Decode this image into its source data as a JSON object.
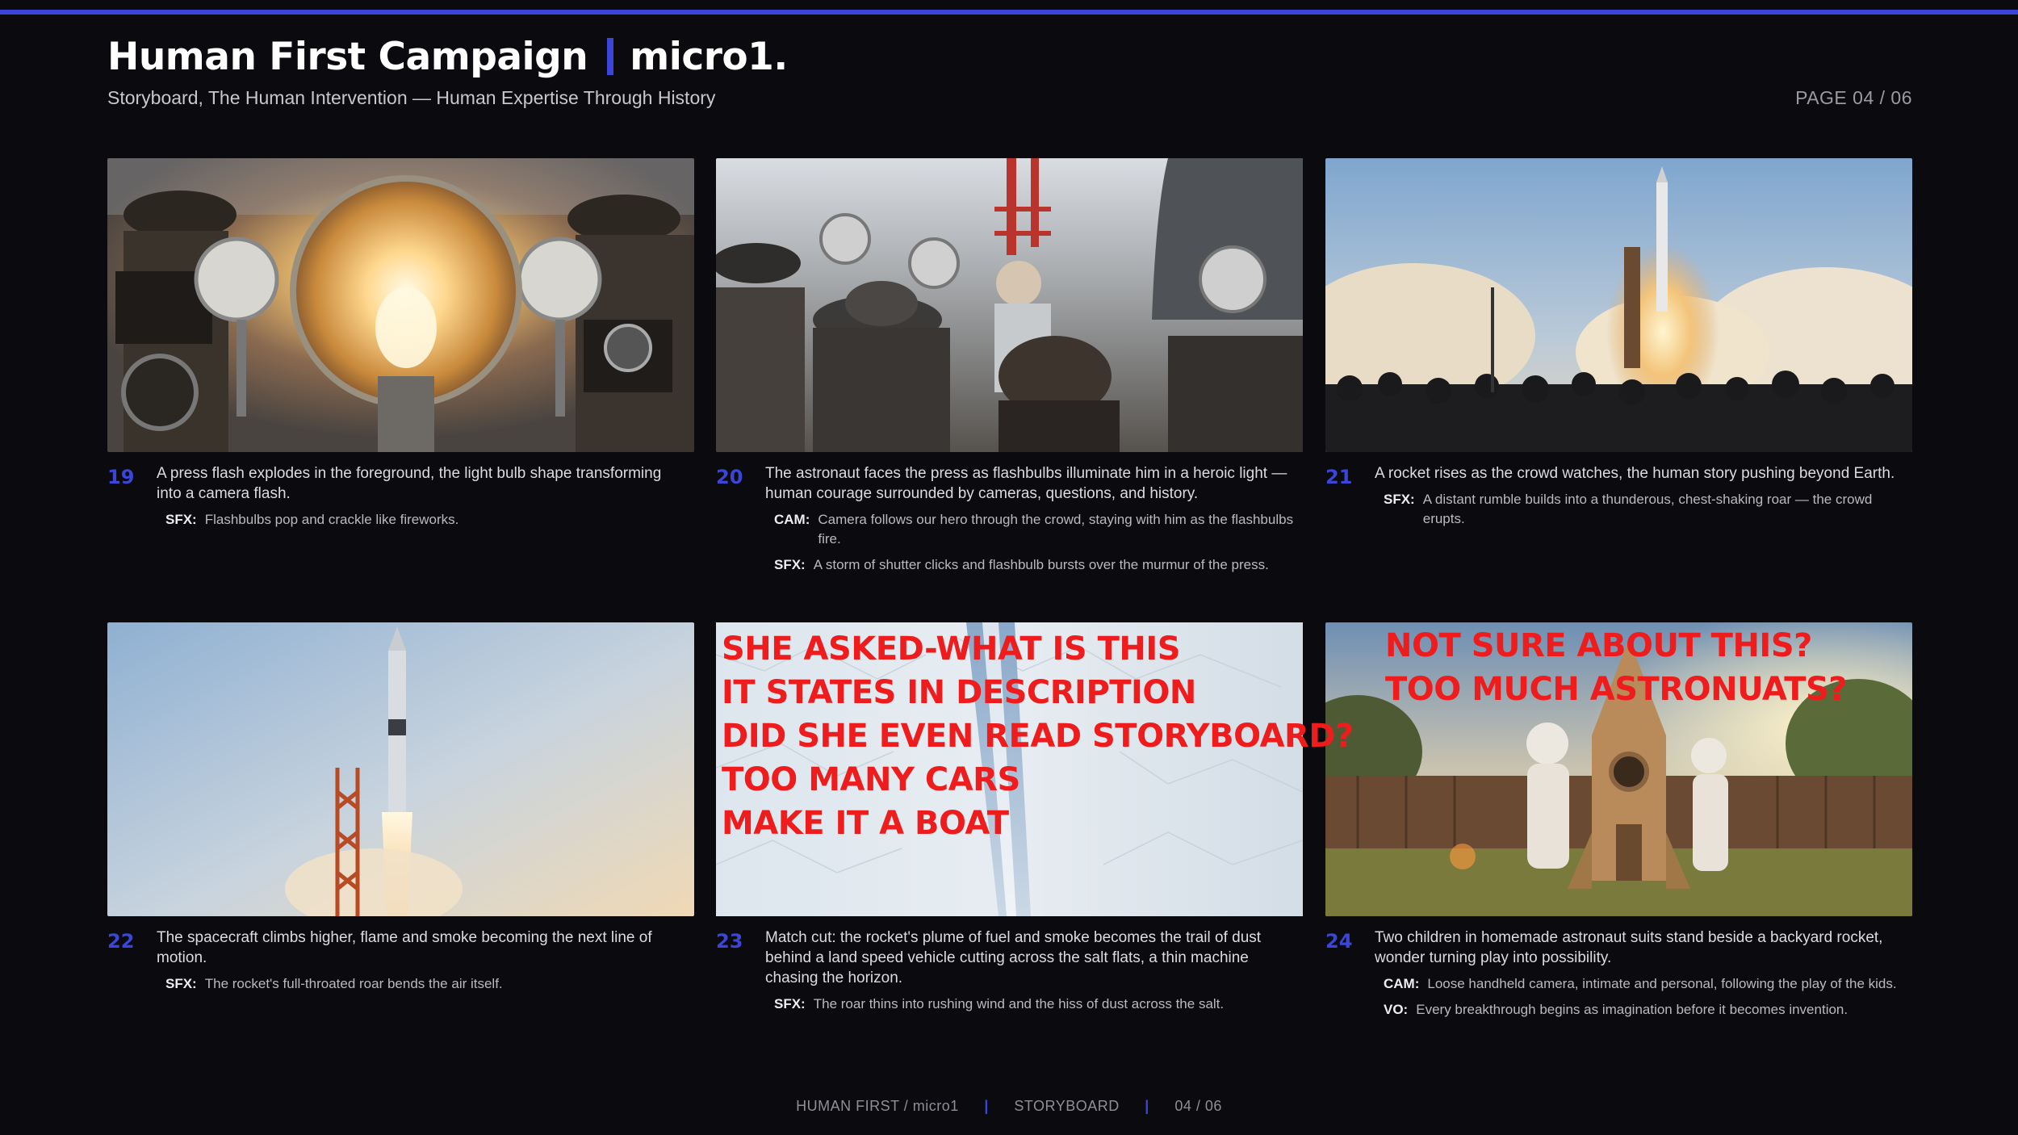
{
  "header": {
    "title": "Human First Campaign",
    "brand": "micro1.",
    "subtitle": "Storyboard, The Human Intervention — Human Expertise Through History",
    "page": "PAGE 04 / 06"
  },
  "panels": [
    {
      "num": "19",
      "desc": "A press flash explodes in the foreground, the light bulb shape transforming into a camera flash.",
      "notes": [
        {
          "label": "SFX:",
          "text": "Flashbulbs pop and crackle like fireworks."
        }
      ]
    },
    {
      "num": "20",
      "desc": "The astronaut faces the press as flashbulbs illuminate him in a heroic light — human courage surrounded by cameras, questions, and history.",
      "notes": [
        {
          "label": "CAM:",
          "text": "Camera follows our hero through the crowd, staying with him as the flashbulbs fire."
        },
        {
          "label": "SFX:",
          "text": "A storm of shutter clicks and flashbulb bursts over the murmur of the press."
        }
      ]
    },
    {
      "num": "21",
      "desc": "A rocket rises as the crowd watches, the human story pushing beyond Earth.",
      "notes": [
        {
          "label": "SFX:",
          "text": "A distant rumble builds into a thunderous, chest-shaking roar — the crowd erupts."
        }
      ]
    },
    {
      "num": "22",
      "desc": "The spacecraft climbs higher, flame and smoke becoming the next line of motion.",
      "notes": [
        {
          "label": "SFX:",
          "text": "The rocket's full-throated roar bends the air itself."
        }
      ]
    },
    {
      "num": "23",
      "desc": "Match cut: the rocket's plume of fuel and smoke becomes the trail of dust behind a land speed vehicle cutting across the salt flats, a thin machine chasing the horizon.",
      "notes": [
        {
          "label": "SFX:",
          "text": "The roar thins into rushing wind and the hiss of dust across the salt."
        }
      ],
      "overlay": [
        "SHE ASKED-WHAT IS THIS",
        "IT STATES IN DESCRIPTION",
        "DID SHE EVEN READ STORYBOARD?",
        "TOO MANY CARS",
        "MAKE IT A BOAT"
      ]
    },
    {
      "num": "24",
      "desc": "Two children in homemade astronaut suits stand beside a backyard rocket, wonder turning play into possibility.",
      "notes": [
        {
          "label": "CAM:",
          "text": "Loose handheld camera, intimate and personal, following the play of the kids."
        },
        {
          "label": "VO:",
          "text": "Every breakthrough begins as imagination before it becomes invention."
        }
      ],
      "overlay": [
        "NOT SURE ABOUT THIS?",
        "TOO MUCH ASTRONUATS?"
      ]
    }
  ],
  "footer": {
    "left": "HUMAN FIRST / micro1",
    "sep": "|",
    "middle": "STORYBOARD",
    "right": "04 / 06"
  },
  "colors": {
    "accent": "#3b46d8",
    "overlay_red": "#ee1c1c",
    "background": "#0b0b0f"
  }
}
